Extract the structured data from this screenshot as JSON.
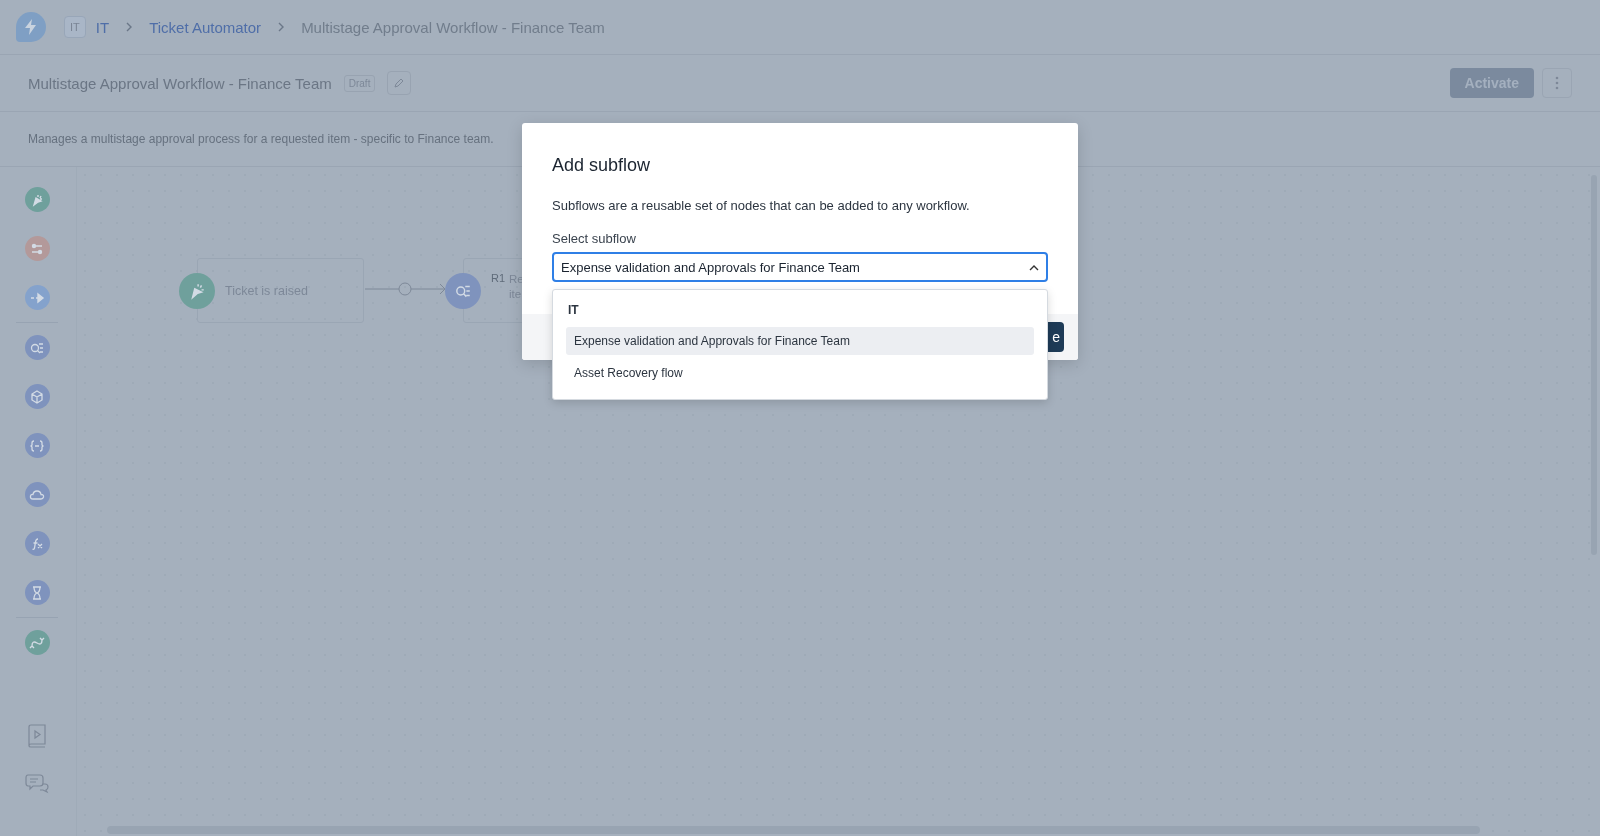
{
  "breadcrumb": {
    "workspace_badge": "IT",
    "workspace": "IT",
    "items": [
      {
        "label": "Ticket Automator",
        "kind": "link"
      },
      {
        "label": "Multistage Approval Workflow - Finance Team",
        "kind": "current"
      }
    ]
  },
  "workflow": {
    "title": "Multistage Approval Workflow - Finance Team",
    "status": "Draft",
    "description": "Manages a multistage approval process for a requested item - specific to Finance team.",
    "primary_action": "Activate"
  },
  "palette": [
    {
      "kind": "trigger",
      "color": "#6fa09c"
    },
    {
      "kind": "settings",
      "color": "#b3999a"
    },
    {
      "kind": "send",
      "color": "#84a2cc"
    },
    {
      "kind": "lookup",
      "color": "#7f93bd"
    },
    {
      "kind": "package",
      "color": "#7f93bd"
    },
    {
      "kind": "variable",
      "color": "#7f93bd"
    },
    {
      "kind": "api",
      "color": "#7f93bd"
    },
    {
      "kind": "formula",
      "color": "#7f93bd"
    },
    {
      "kind": "delay",
      "color": "#7f93bd"
    },
    {
      "kind": "subflow",
      "color": "#6fa09c"
    }
  ],
  "nodes": [
    {
      "kind": "trigger",
      "label": "Ticket is raised"
    },
    {
      "kind": "lookup",
      "prefix": "R1",
      "label_lines": [
        "Re",
        "ite"
      ]
    }
  ],
  "dialog": {
    "title": "Add subflow",
    "description": "Subflows are a reusable set of nodes that can be added to any workflow.",
    "field_label": "Select subflow",
    "value": "Expense validation and Approvals for Finance Team",
    "expanded": true,
    "group": "IT",
    "options": [
      {
        "label": "Expense validation and Approvals for Finance Team",
        "selected": true
      },
      {
        "label": "Asset Recovery flow",
        "selected": false
      }
    ],
    "footer_button": "e"
  }
}
